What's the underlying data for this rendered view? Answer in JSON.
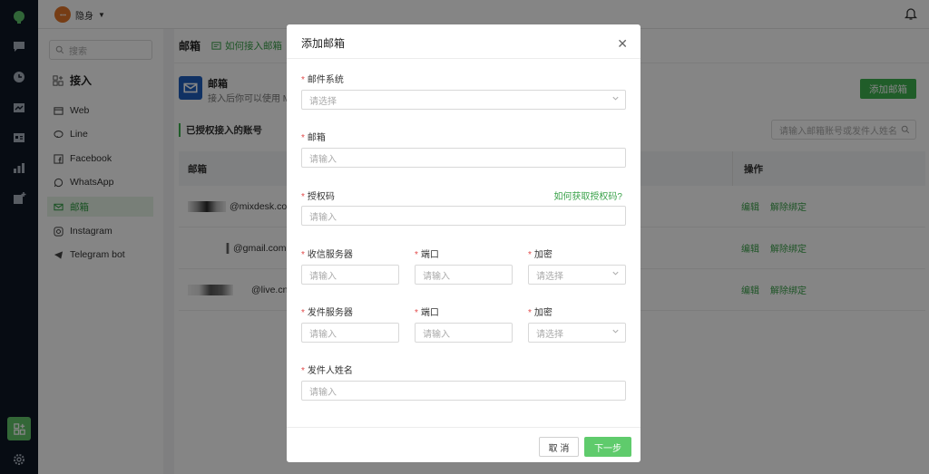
{
  "app": {
    "status_label": "隐身",
    "accent_color": "#3fb24f"
  },
  "sidebar": {
    "search_placeholder": "搜索",
    "section_title": "接入",
    "items": [
      {
        "label": "Web",
        "icon": "browser-icon"
      },
      {
        "label": "Line",
        "icon": "line-icon"
      },
      {
        "label": "Facebook",
        "icon": "facebook-icon"
      },
      {
        "label": "WhatsApp",
        "icon": "whatsapp-icon"
      },
      {
        "label": "邮箱",
        "icon": "mail-icon",
        "active": true
      },
      {
        "label": "Instagram",
        "icon": "instagram-icon"
      },
      {
        "label": "Telegram bot",
        "icon": "telegram-icon"
      }
    ]
  },
  "main": {
    "title": "邮箱",
    "how_to_link": "如何接入邮箱",
    "card_title": "邮箱",
    "card_desc": "接入后你可以使用 M",
    "add_button": "添加邮箱",
    "accounts_title": "已授权接入的账号",
    "table_search_placeholder": "请输入邮箱账号或发件人姓名",
    "columns": {
      "email": "邮箱",
      "actions": "操作"
    },
    "rows": [
      {
        "email": "@mixdesk.com",
        "edit": "编辑",
        "unbind": "解除绑定"
      },
      {
        "email": "@gmail.com",
        "edit": "编辑",
        "unbind": "解除绑定"
      },
      {
        "email": "@live.cn",
        "edit": "编辑",
        "unbind": "解除绑定"
      }
    ]
  },
  "modal": {
    "title": "添加邮箱",
    "mail_system_label": "邮件系统",
    "mail_system_placeholder": "请选择",
    "email_label": "邮箱",
    "email_placeholder": "请输入",
    "auth_code_label": "授权码",
    "auth_code_help": "如何获取授权码?",
    "auth_code_placeholder": "请输入",
    "incoming_server_label": "收信服务器",
    "incoming_server_placeholder": "请输入",
    "incoming_port_label": "端口",
    "incoming_port_placeholder": "请输入",
    "incoming_encrypt_label": "加密",
    "incoming_encrypt_placeholder": "请选择",
    "outgoing_server_label": "发件服务器",
    "outgoing_server_placeholder": "请输入",
    "outgoing_port_label": "端口",
    "outgoing_port_placeholder": "请输入",
    "outgoing_encrypt_label": "加密",
    "outgoing_encrypt_placeholder": "请选择",
    "sender_name_label": "发件人姓名",
    "sender_name_placeholder": "请输入",
    "cancel_button": "取 消",
    "next_button": "下一步"
  }
}
